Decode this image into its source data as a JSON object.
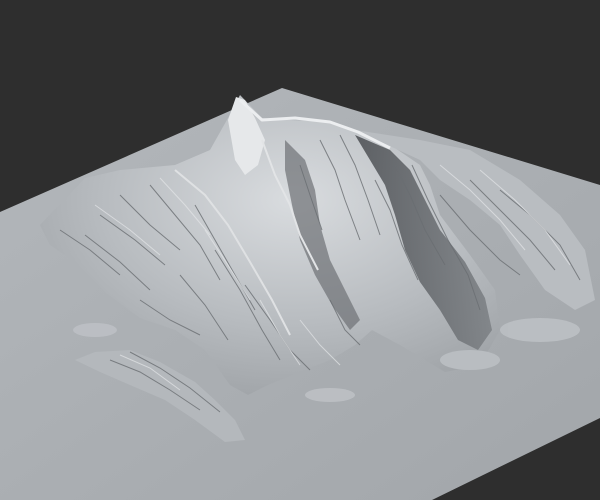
{
  "viewport": {
    "background_color": "#2e2e2e",
    "subject": "terrain-mesh",
    "colors": {
      "plane": "#a9adb1",
      "plane_edge_shadow": "#8f9397",
      "rock_light": "#e6e8ea",
      "rock_mid": "#b9bdc1",
      "rock_dark": "#5f6367",
      "rock_shadow": "#3f4246"
    }
  }
}
